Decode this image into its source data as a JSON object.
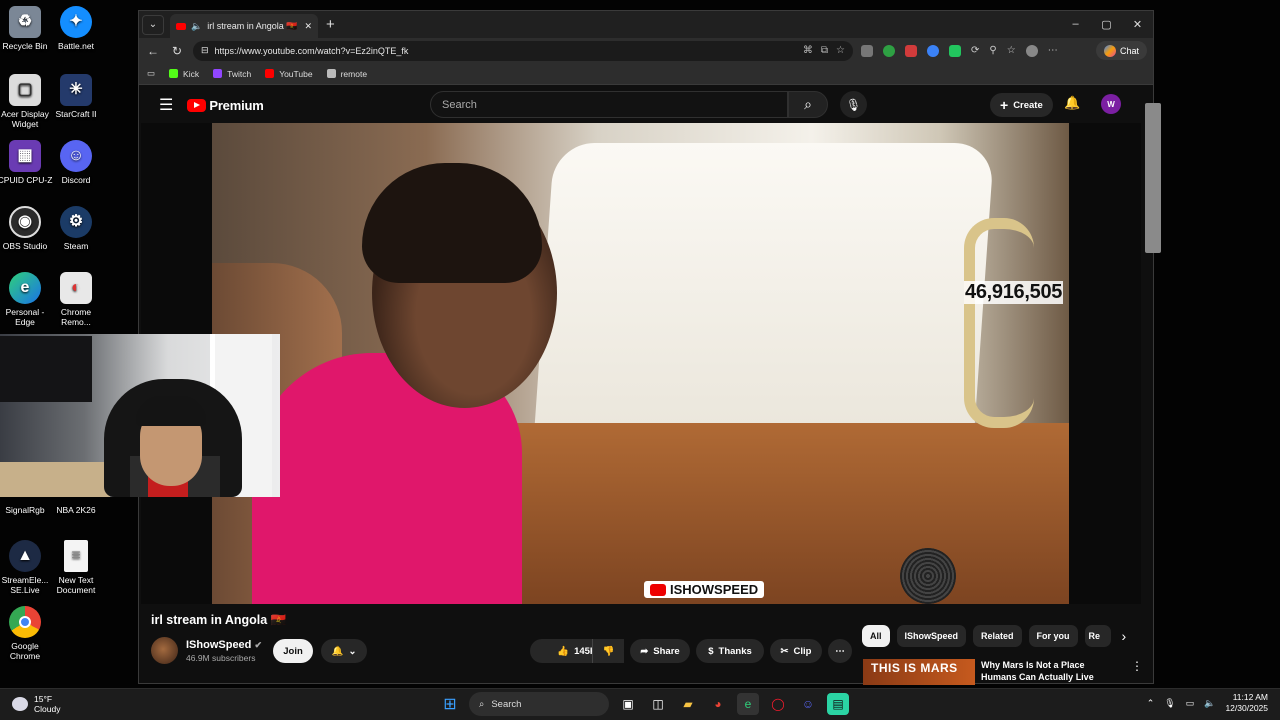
{
  "desktop": {
    "icons": [
      {
        "label": "Recycle Bin"
      },
      {
        "label": "Battle.net"
      },
      {
        "label": "Acer Display Widget"
      },
      {
        "label": "StarCraft II"
      },
      {
        "label": "CPUID CPU-Z"
      },
      {
        "label": "Discord"
      },
      {
        "label": "OBS Studio"
      },
      {
        "label": "Steam"
      },
      {
        "label": "Personal - Edge"
      },
      {
        "label": "Chrome Remo..."
      },
      {
        "label": "SignalRgb"
      },
      {
        "label": "NBA 2K26"
      },
      {
        "label": "StreamEle... SE.Live"
      },
      {
        "label": "New Text Document"
      },
      {
        "label": "Google Chrome"
      }
    ]
  },
  "browser": {
    "tab_title": "irl stream in Angola 🇦🇴 - YouTube",
    "url": "https://www.youtube.com/watch?v=Ez2inQTE_fk",
    "chat_label": "Chat",
    "bookmarks": [
      {
        "label": "Kick",
        "color": "#53fc18"
      },
      {
        "label": "Twitch",
        "color": "#9146ff"
      },
      {
        "label": "YouTube",
        "color": "#ff0000"
      },
      {
        "label": "remote",
        "color": "#bbbbbb"
      }
    ]
  },
  "youtube": {
    "logo": "Premium",
    "search_placeholder": "Search",
    "create_label": "Create",
    "avatar_letter": "W",
    "counter": "46,916,505",
    "watermark": "ISHOWSPEED",
    "video_title": "irl stream in Angola 🇦🇴",
    "channel_name": "IShowSpeed",
    "subscribers": "46.9M subscribers",
    "join_label": "Join",
    "like_count": "145K",
    "share_label": "Share",
    "thanks_label": "Thanks",
    "clip_label": "Clip",
    "chips": [
      "All",
      "IShowSpeed",
      "Related",
      "For you",
      "Re"
    ],
    "rec_thumb_text": "THIS IS MARS",
    "rec_title": "Why Mars Is Not a Place Humans Can Actually Live"
  },
  "taskbar": {
    "temperature": "15°F",
    "condition": "Cloudy",
    "search_label": "Search",
    "time": "11:12 AM",
    "date": "12/30/2025"
  }
}
